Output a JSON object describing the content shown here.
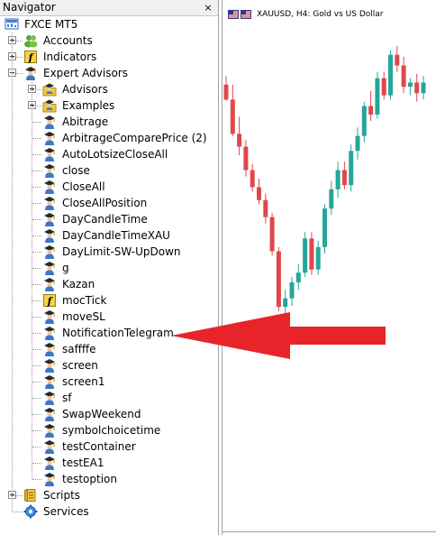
{
  "navigator": {
    "title": "Navigator",
    "close_glyph": "×",
    "root": {
      "label": "FXCE MT5",
      "icon": "terminal-icon"
    },
    "groups": [
      {
        "label": "Accounts",
        "icon": "accounts-icon",
        "expander": "+"
      },
      {
        "label": "Indicators",
        "icon": "indicator-icon",
        "expander": "+"
      },
      {
        "label": "Expert Advisors",
        "icon": "expert-advisor-icon",
        "expander": "-"
      },
      {
        "label": "Scripts",
        "icon": "scripts-icon",
        "expander": "+"
      },
      {
        "label": "Services",
        "icon": "services-icon",
        "expander": ""
      }
    ],
    "ea_folders": [
      {
        "label": "Advisors",
        "icon": "folder-expert-icon",
        "expander": "+"
      },
      {
        "label": "Examples",
        "icon": "folder-expert-icon",
        "expander": "+"
      }
    ],
    "ea_items": [
      {
        "label": "Abitrage",
        "icon": "expert-advisor-icon"
      },
      {
        "label": "ArbitrageComparePrice (2)",
        "icon": "expert-advisor-icon"
      },
      {
        "label": "AutoLotsizeCloseAll",
        "icon": "expert-advisor-icon"
      },
      {
        "label": "close",
        "icon": "expert-advisor-icon"
      },
      {
        "label": "CloseAll",
        "icon": "expert-advisor-icon"
      },
      {
        "label": "CloseAllPosition",
        "icon": "expert-advisor-icon"
      },
      {
        "label": "DayCandleTime",
        "icon": "expert-advisor-icon"
      },
      {
        "label": "DayCandleTimeXAU",
        "icon": "expert-advisor-icon"
      },
      {
        "label": "DayLimit-SW-UpDown",
        "icon": "expert-advisor-icon"
      },
      {
        "label": "g",
        "icon": "expert-advisor-icon"
      },
      {
        "label": "Kazan",
        "icon": "expert-advisor-icon"
      },
      {
        "label": "mocTick",
        "icon": "indicator-icon"
      },
      {
        "label": "moveSL",
        "icon": "expert-advisor-icon"
      },
      {
        "label": "NotificationTelegram",
        "icon": "expert-advisor-icon"
      },
      {
        "label": "saffffe",
        "icon": "expert-advisor-icon"
      },
      {
        "label": "screen",
        "icon": "expert-advisor-icon"
      },
      {
        "label": "screen1",
        "icon": "expert-advisor-icon"
      },
      {
        "label": "sf",
        "icon": "expert-advisor-icon"
      },
      {
        "label": "SwapWeekend",
        "icon": "expert-advisor-icon"
      },
      {
        "label": "symbolchoicetime",
        "icon": "expert-advisor-icon"
      },
      {
        "label": "testContainer",
        "icon": "expert-advisor-icon"
      },
      {
        "label": "testEA1",
        "icon": "expert-advisor-icon"
      },
      {
        "label": "testoption",
        "icon": "expert-advisor-icon"
      }
    ],
    "highlighted_item": "NotificationTelegram"
  },
  "chart": {
    "title": "XAUUSD, H4:  Gold vs US Dollar",
    "bull_color": "#26a69a",
    "bear_color": "#e0474c",
    "candles": [
      {
        "o": 2018,
        "h": 2026,
        "l": 2003,
        "c": 2004
      },
      {
        "o": 2004,
        "h": 2018,
        "l": 1970,
        "c": 1972
      },
      {
        "o": 1972,
        "h": 1988,
        "l": 1952,
        "c": 1960
      },
      {
        "o": 1960,
        "h": 1966,
        "l": 1932,
        "c": 1938
      },
      {
        "o": 1938,
        "h": 1944,
        "l": 1918,
        "c": 1922
      },
      {
        "o": 1922,
        "h": 1930,
        "l": 1906,
        "c": 1910
      },
      {
        "o": 1910,
        "h": 1916,
        "l": 1888,
        "c": 1894
      },
      {
        "o": 1894,
        "h": 1898,
        "l": 1858,
        "c": 1862
      },
      {
        "o": 1862,
        "h": 1866,
        "l": 1806,
        "c": 1810
      },
      {
        "o": 1810,
        "h": 1826,
        "l": 1801,
        "c": 1818
      },
      {
        "o": 1818,
        "h": 1838,
        "l": 1811,
        "c": 1833
      },
      {
        "o": 1833,
        "h": 1850,
        "l": 1826,
        "c": 1842
      },
      {
        "o": 1842,
        "h": 1880,
        "l": 1838,
        "c": 1874
      },
      {
        "o": 1874,
        "h": 1880,
        "l": 1840,
        "c": 1845
      },
      {
        "o": 1845,
        "h": 1872,
        "l": 1840,
        "c": 1866
      },
      {
        "o": 1866,
        "h": 1906,
        "l": 1860,
        "c": 1902
      },
      {
        "o": 1902,
        "h": 1928,
        "l": 1896,
        "c": 1920
      },
      {
        "o": 1920,
        "h": 1946,
        "l": 1912,
        "c": 1938
      },
      {
        "o": 1938,
        "h": 1946,
        "l": 1920,
        "c": 1924
      },
      {
        "o": 1924,
        "h": 1962,
        "l": 1918,
        "c": 1956
      },
      {
        "o": 1956,
        "h": 1978,
        "l": 1948,
        "c": 1970
      },
      {
        "o": 1970,
        "h": 2002,
        "l": 1964,
        "c": 1998
      },
      {
        "o": 1998,
        "h": 2012,
        "l": 1984,
        "c": 1990
      },
      {
        "o": 1990,
        "h": 2030,
        "l": 1986,
        "c": 2024
      },
      {
        "o": 2024,
        "h": 2030,
        "l": 2004,
        "c": 2008
      },
      {
        "o": 2008,
        "h": 2050,
        "l": 2004,
        "c": 2046
      },
      {
        "o": 2046,
        "h": 2054,
        "l": 2030,
        "c": 2036
      },
      {
        "o": 2036,
        "h": 2044,
        "l": 2010,
        "c": 2016
      },
      {
        "o": 2016,
        "h": 2024,
        "l": 2008,
        "c": 2020
      },
      {
        "o": 2020,
        "h": 2028,
        "l": 2002,
        "c": 2010
      },
      {
        "o": 2010,
        "h": 2026,
        "l": 2004,
        "c": 2020
      }
    ],
    "price_range": [
      1800,
      2055
    ]
  },
  "annotation": {
    "type": "arrow",
    "color": "#e8242b",
    "points_to": "NotificationTelegram"
  }
}
